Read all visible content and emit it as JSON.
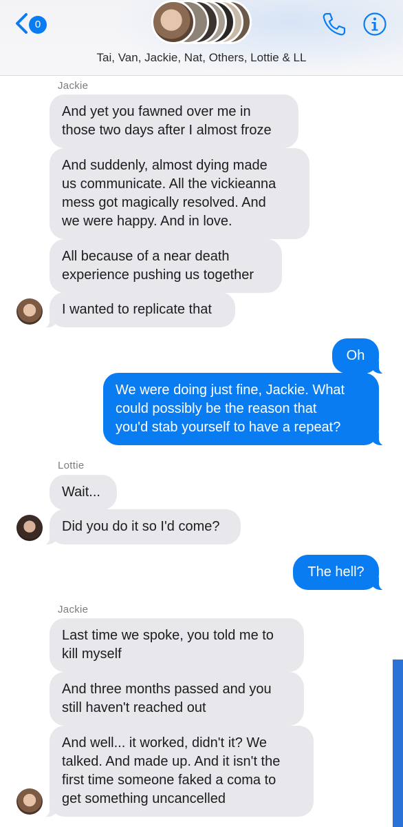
{
  "header": {
    "back_badge": "0",
    "group_title": "Tai, Van, Jackie, Nat, Others, Lottie & LL",
    "accent_color": "#0a7cf2",
    "icons": [
      "back-chevron-icon",
      "phone-icon",
      "info-icon"
    ]
  },
  "messages": [
    {
      "sender": "Jackie"
    },
    {
      "text": "And yet you fawned over me in\nthose two days after I almost froze"
    },
    {
      "text": "And suddenly, almost dying made\nus communicate. All the vickieanna\nmess got magically resolved. And\nwe were happy. And in love."
    },
    {
      "text": "All because  of a near death\nexperience pushing us together"
    },
    {
      "text": "I wanted to replicate that"
    },
    {
      "text": "Oh"
    },
    {
      "text": "We were doing just fine, Jackie. What\ncould possibly be the reason that\nyou'd stab yourself to have a repeat?"
    },
    {
      "sender": "Lottie"
    },
    {
      "text": "Wait..."
    },
    {
      "text": "Did you do it so I'd come?"
    },
    {
      "text": "The hell?"
    },
    {
      "sender": "Jackie"
    },
    {
      "text": "Last time we spoke, you told me to\nkill myself"
    },
    {
      "text": "And three months passed and you\nstill haven't reached out"
    },
    {
      "text": "And well... it worked, didn't it? We\ntalked. And made up. And it isn't the\nfirst time someone faked a coma to\nget something  uncancelled"
    }
  ],
  "colors": {
    "incoming_bubble": "#e7e7ec",
    "outgoing_bubble": "#0a7cf2",
    "scrollbar": "#2a72d6"
  }
}
